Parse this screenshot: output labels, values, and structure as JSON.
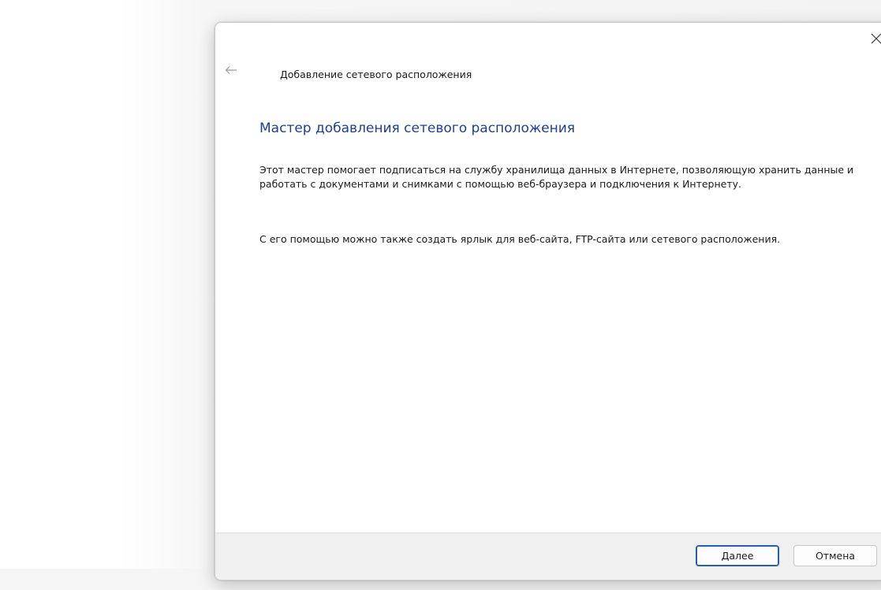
{
  "dialog": {
    "window_title": "Добавление сетевого расположения",
    "heading": "Мастер добавления сетевого расположения",
    "paragraph_1": "Этот мастер помогает подписаться на службу хранилища данных в Интернете, позволяющую хранить данные и работать с документами и снимками с помощью веб-браузера и подключения к Интернету.",
    "paragraph_2": "С его помощью можно также создать ярлык для веб-сайта, FTP-сайта или сетевого расположения.",
    "icons": {
      "back": "back-arrow-icon",
      "close": "close-icon"
    },
    "colors": {
      "heading": "#1c3f9e",
      "accent": "#1f5fbf"
    }
  },
  "footer": {
    "next_label": "Далее",
    "cancel_label": "Отмена"
  }
}
